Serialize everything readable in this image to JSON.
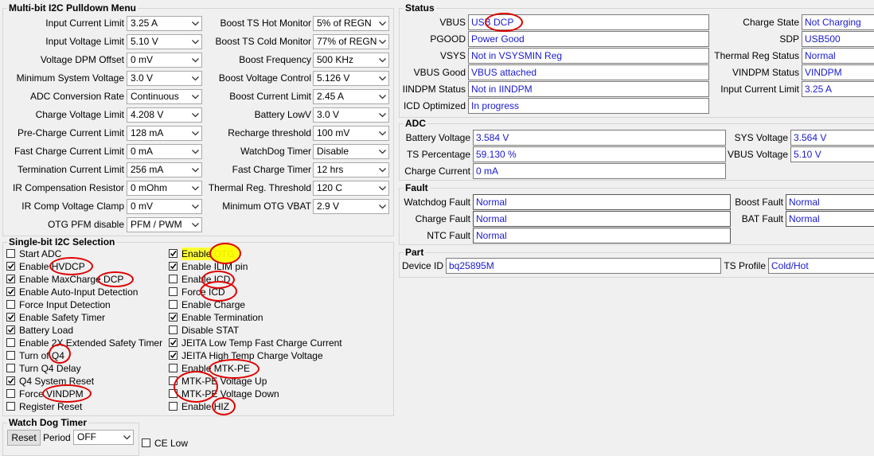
{
  "multibit": {
    "title": "Multi-bit I2C Pulldown Menu",
    "left": [
      {
        "label": "Input Current Limit",
        "value": "3.25 A"
      },
      {
        "label": "Input Voltage Limit",
        "value": "5.10 V"
      },
      {
        "label": "Voltage DPM Offset",
        "value": "0 mV"
      },
      {
        "label": "Minimum System Voltage",
        "value": "3.0 V"
      },
      {
        "label": "ADC Conversion Rate",
        "value": "Continuous"
      },
      {
        "label": "Charge Voltage Limit",
        "value": "4.208 V"
      },
      {
        "label": "Pre-Charge Current Limit",
        "value": "128 mA"
      },
      {
        "label": "Fast Charge Current Limit",
        "value": "0 mA"
      },
      {
        "label": "Termination Current Limit",
        "value": "256 mA"
      },
      {
        "label": "IR Compensation Resistor",
        "value": "0 mOhm"
      },
      {
        "label": "IR Comp Voltage Clamp",
        "value": "0 mV"
      },
      {
        "label": "OTG PFM disable",
        "value": "PFM / PWM"
      }
    ],
    "right": [
      {
        "label": "Boost TS Hot Monitor",
        "value": "5% of REGN"
      },
      {
        "label": "Boost TS Cold Monitor",
        "value": "77% of REGN"
      },
      {
        "label": "Boost Frequency",
        "value": "500 KHz"
      },
      {
        "label": "Boost Voltage Control",
        "value": "5.126 V"
      },
      {
        "label": "Boost Current Limit",
        "value": "2.45 A"
      },
      {
        "label": "Battery LowV",
        "value": "3.0 V"
      },
      {
        "label": "Recharge threshold",
        "value": "100 mV"
      },
      {
        "label": "WatchDog Timer",
        "value": "Disable"
      },
      {
        "label": "Fast Charge Timer",
        "value": "12 hrs"
      },
      {
        "label": "Thermal Reg. Threshold",
        "value": "120 C"
      },
      {
        "label": "Minimum OTG VBAT",
        "value": "2.9 V"
      }
    ]
  },
  "singlebit": {
    "title": "Single-bit I2C Selection",
    "left": [
      {
        "label": "Start ADC",
        "checked": false
      },
      {
        "label": "Enable HVDCP",
        "checked": true
      },
      {
        "label": "Enable MaxCharge DCP",
        "checked": true
      },
      {
        "label": "Enable Auto-Input Detection",
        "checked": true
      },
      {
        "label": "Force Input Detection",
        "checked": false
      },
      {
        "label": "Enable Safety Timer",
        "checked": true
      },
      {
        "label": "Battery Load",
        "checked": true
      },
      {
        "label": "Enable 2X Extended Safety Timer",
        "checked": false
      },
      {
        "label": "Turn of Q4",
        "checked": false
      },
      {
        "label": "Turn Q4 Delay",
        "checked": false
      },
      {
        "label": "Q4 System Reset",
        "checked": true
      },
      {
        "label": "Force VINDPM",
        "checked": false
      },
      {
        "label": "Register Reset",
        "checked": false
      }
    ],
    "right": [
      {
        "label": "Enable OTG",
        "checked": true
      },
      {
        "label": "Enable ILIM pin",
        "checked": true
      },
      {
        "label": "Enable ICD",
        "checked": false
      },
      {
        "label": "Force ICD",
        "checked": false
      },
      {
        "label": "Enable Charge",
        "checked": false
      },
      {
        "label": "Enable Termination",
        "checked": true
      },
      {
        "label": "Disable STAT",
        "checked": false
      },
      {
        "label": "JEITA Low Temp Fast Charge Current",
        "checked": true
      },
      {
        "label": "JEITA High Temp Charge Voltage",
        "checked": true
      },
      {
        "label": "Enable MTK-PE",
        "checked": false
      },
      {
        "label": "MTK-PE Voltage Up",
        "checked": false
      },
      {
        "label": "MTK-PE Voltage Down",
        "checked": false
      },
      {
        "label": "Enable HIZ",
        "checked": false
      }
    ]
  },
  "watchdog": {
    "title": "Watch Dog Timer",
    "reset_label": "Reset",
    "period_label": "Period",
    "period_value": "OFF",
    "ce_label": "CE Low"
  },
  "status": {
    "title": "Status",
    "left": [
      {
        "label": "VBUS",
        "value": "USB DCP"
      },
      {
        "label": "PGOOD",
        "value": "Power Good"
      },
      {
        "label": "VSYS",
        "value": "Not in VSYSMIN Reg"
      },
      {
        "label": "VBUS Good",
        "value": "VBUS attached"
      },
      {
        "label": "IINDPM Status",
        "value": "Not in IINDPM"
      },
      {
        "label": "ICD Optimized",
        "value": "In progress"
      }
    ],
    "right": [
      {
        "label": "Charge State",
        "value": "Not Charging"
      },
      {
        "label": "SDP",
        "value": "USB500"
      },
      {
        "label": "Thermal Reg Status",
        "value": "Normal"
      },
      {
        "label": "VINDPM Status",
        "value": "VINDPM"
      },
      {
        "label": "Input Current Limit",
        "value": "3.25 A"
      }
    ]
  },
  "adc": {
    "title": "ADC",
    "left": [
      {
        "label": "Battery Voltage",
        "value": "3.584 V"
      },
      {
        "label": "TS Percentage",
        "value": "59.130 %"
      },
      {
        "label": "Charge Current",
        "value": "0 mA"
      }
    ],
    "right": [
      {
        "label": "SYS Voltage",
        "value": "3.564 V"
      },
      {
        "label": "VBUS Voltage",
        "value": "5.10 V"
      }
    ]
  },
  "fault": {
    "title": "Fault",
    "left": [
      {
        "label": "Watchdog Fault",
        "value": "Normal"
      },
      {
        "label": "Charge Fault",
        "value": "Normal"
      },
      {
        "label": "NTC Fault",
        "value": "Normal"
      }
    ],
    "right": [
      {
        "label": "Boost Fault",
        "value": "Normal"
      },
      {
        "label": "BAT Fault",
        "value": "Normal"
      }
    ]
  },
  "part": {
    "title": "Part",
    "device_id_label": "Device ID",
    "device_id_value": "bq25895M",
    "ts_profile_label": "TS Profile",
    "ts_profile_value": "Cold/Hot"
  },
  "colors": {
    "value_text": "#1a1ad0",
    "annotation": "#e00000",
    "highlight": "#ffff00"
  },
  "icons": {
    "dropdown": "chevron-down-icon",
    "checkbox": "checkmark-icon"
  }
}
